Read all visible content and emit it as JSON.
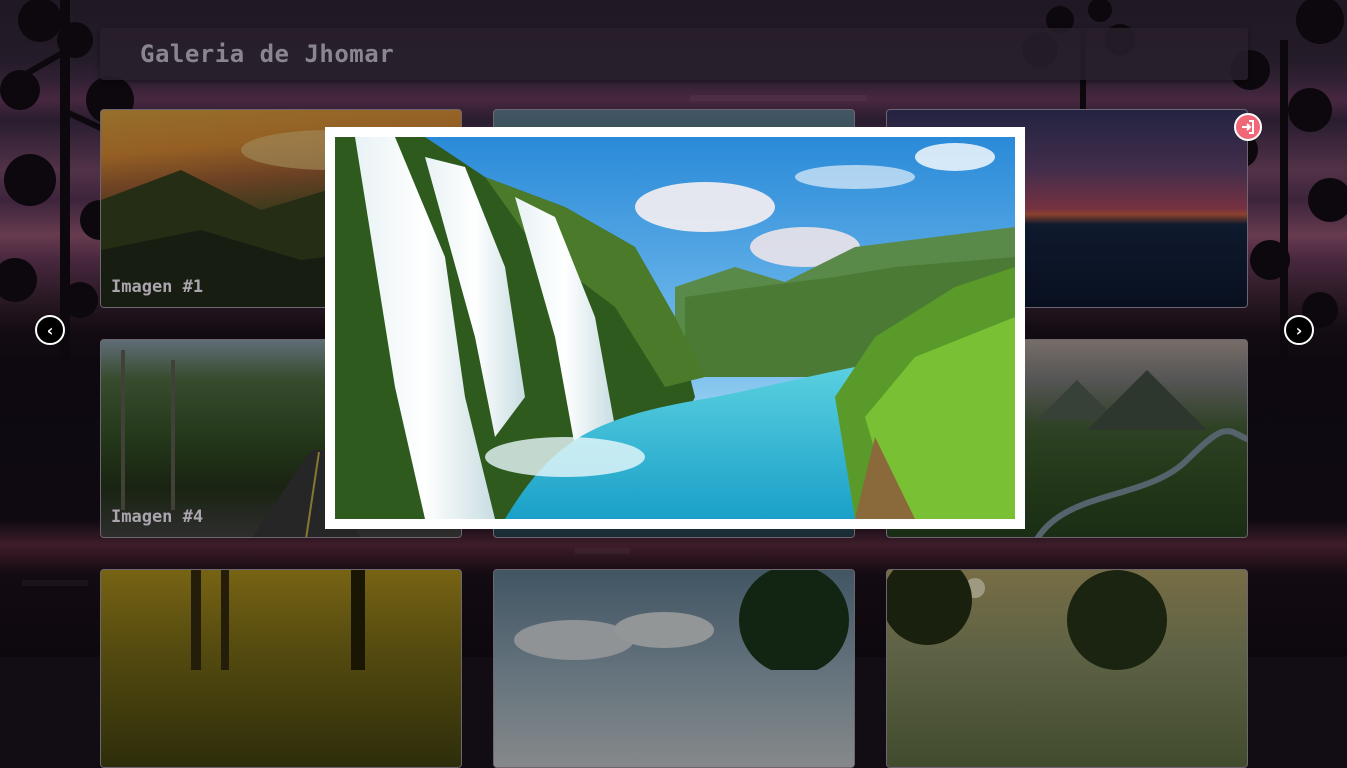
{
  "header": {
    "title": "Galeria de Jhomar"
  },
  "gallery": {
    "cards": [
      {
        "label": "Imagen #1"
      },
      {
        "label": ""
      },
      {
        "label": ""
      },
      {
        "label": "Imagen #4"
      },
      {
        "label": ""
      },
      {
        "label": ""
      },
      {
        "label": ""
      },
      {
        "label": ""
      },
      {
        "label": ""
      }
    ]
  },
  "lightbox": {
    "prev_icon": "chevron-left-icon",
    "next_icon": "chevron-right-icon",
    "close_icon": "exit-icon",
    "prev_glyph": "‹",
    "next_glyph": "›"
  },
  "colors": {
    "close_button": "#f06878",
    "header_text": "#8a8590",
    "card_label": "#a9a4ad"
  }
}
